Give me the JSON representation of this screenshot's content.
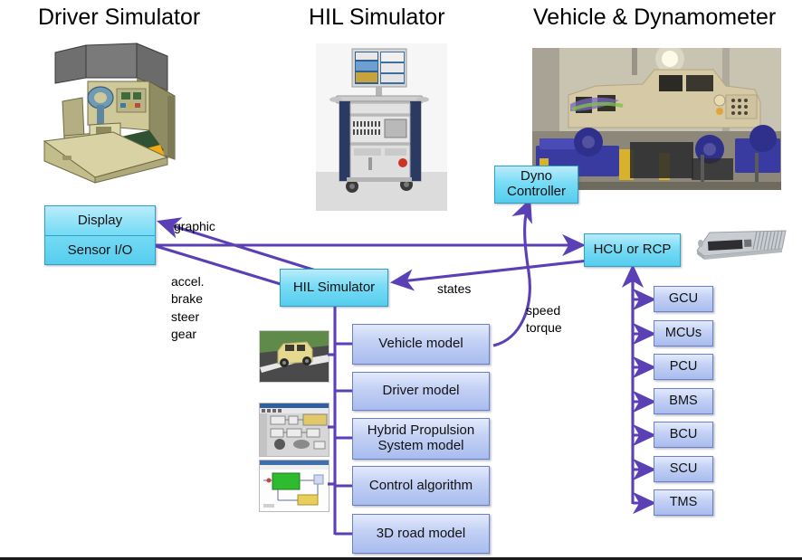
{
  "titles": {
    "driver_simulator": "Driver Simulator",
    "hil_simulator": "HIL Simulator",
    "vehicle_dyno": "Vehicle & Dynamometer"
  },
  "boxes": {
    "display": "Display",
    "sensor_io": "Sensor I/O",
    "hil_simulator": "HIL Simulator",
    "dyno_controller_line1": "Dyno",
    "dyno_controller_line2": "Controller",
    "hcu_or_rcp": "HCU or RCP"
  },
  "models": [
    {
      "label": "Vehicle model"
    },
    {
      "label": "Driver model"
    },
    {
      "label": "Hybrid Propulsion\nSystem model"
    },
    {
      "label": "Control algorithm"
    },
    {
      "label": "3D road model"
    }
  ],
  "ecus": [
    {
      "label": "GCU"
    },
    {
      "label": "MCUs"
    },
    {
      "label": "PCU"
    },
    {
      "label": "BMS"
    },
    {
      "label": "BCU"
    },
    {
      "label": "SCU"
    },
    {
      "label": "TMS"
    }
  ],
  "edge_labels": {
    "graphic": "graphic",
    "driver_inputs": "accel.\nbrake\nsteer\ngear",
    "states": "states",
    "speed_torque": "speed\ntorque"
  },
  "images": {
    "driver_cockpit": "driving-simulator-cockpit-photo",
    "hil_rack": "hil-simulator-rack-photo",
    "vehicle_dyno": "vehicle-on-dynamometer-photo",
    "ecu_hardware": "ecu-hardware-photo",
    "vehicle_3d_thumb": "vehicle-3d-model-thumbnail",
    "simulink_thumb": "simulink-model-thumbnail",
    "control_thumb": "control-diagram-thumbnail"
  },
  "colors": {
    "arrow": "#5b3fb5",
    "cyan_box": "#6fd8f2",
    "blue_box": "#b6c6ef",
    "background": "#ffffff"
  }
}
